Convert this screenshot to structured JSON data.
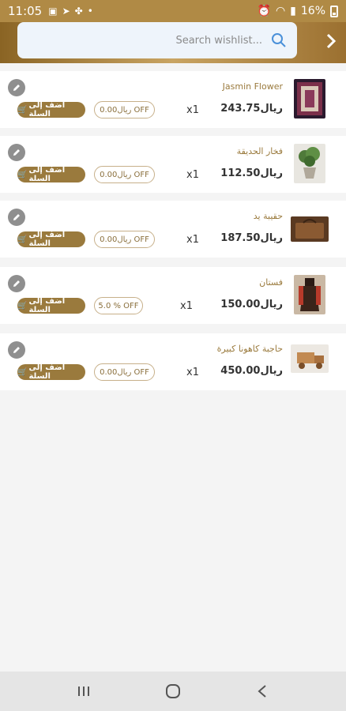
{
  "status": {
    "time": "11:05",
    "battery": "16%"
  },
  "search": {
    "placeholder": "Search wishlist..."
  },
  "labels": {
    "add_to_cart": "أضف إلى السلة",
    "cart_icon": "🛒"
  },
  "items": [
    {
      "name": "Jasmin Flower",
      "price": "243.75ريال",
      "qty": "x1",
      "discount": "0.00ريال OFF",
      "thumb": "rug"
    },
    {
      "name": "فخار الحديقة",
      "price": "112.50ريال",
      "qty": "x1",
      "discount": "0.00ريال OFF",
      "thumb": "plant-pot"
    },
    {
      "name": "حقيبة يد",
      "price": "187.50ريال",
      "qty": "x1",
      "discount": "0.00ريال OFF",
      "thumb": "handbag"
    },
    {
      "name": "فستان",
      "price": "150.00ريال",
      "qty": "x1",
      "discount": "5.0 % OFF",
      "thumb": "dress"
    },
    {
      "name": "حاجبة كاهونا كبيرة",
      "price": "450.00ريال",
      "qty": "x1",
      "discount": "0.00ريال OFF",
      "thumb": "wooden-truck"
    }
  ],
  "colors": {
    "accent": "#9a7a3d",
    "header_gradient_mid": "#c9a462",
    "status_bar": "#b08a45"
  }
}
